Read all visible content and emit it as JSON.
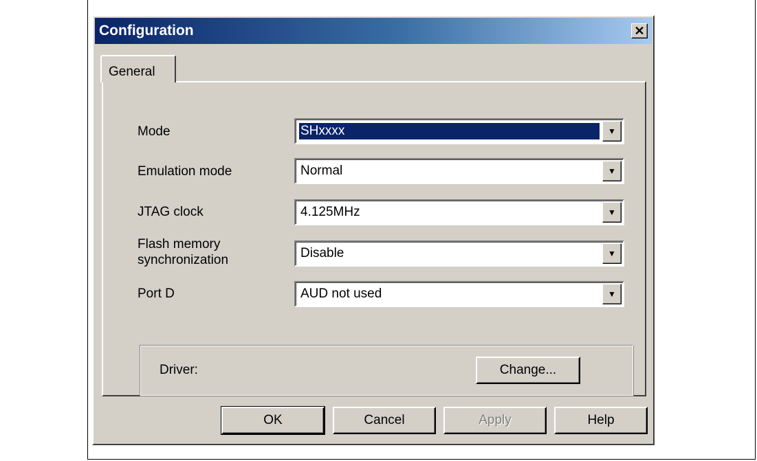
{
  "window": {
    "title": "Configuration",
    "close_glyph": "✕",
    "close_icon": "close-icon"
  },
  "tabs": [
    {
      "label": "General",
      "active": true
    }
  ],
  "fields": [
    {
      "label": "Mode",
      "value": "SHxxxx",
      "selected": true
    },
    {
      "label": "Emulation mode",
      "value": "Normal"
    },
    {
      "label": "JTAG clock",
      "value": "4.125MHz"
    },
    {
      "label_line1": "Flash memory",
      "label_line2": "synchronization",
      "value": "Disable"
    },
    {
      "label": "Port D",
      "value": "AUD not used"
    }
  ],
  "driver": {
    "label": "Driver:",
    "change_button": "Change..."
  },
  "buttons": {
    "ok": "OK",
    "cancel": "Cancel",
    "apply": "Apply",
    "help": "Help"
  },
  "colors": {
    "title_start": "#0a246a",
    "title_end": "#a6caf0",
    "dialog_bg": "#d4d0c8",
    "selection": "#0a246a"
  }
}
